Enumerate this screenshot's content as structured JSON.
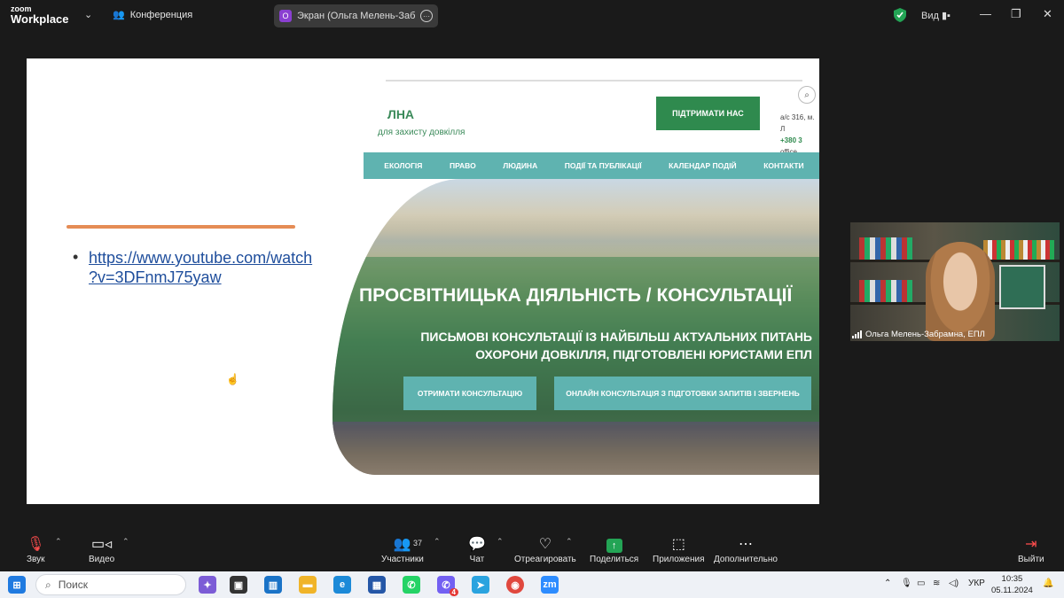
{
  "zoom": {
    "logo_top": "zoom",
    "logo_bottom": "Workplace",
    "meeting_label": "Конференция",
    "share_label": "Экран (Ольга Мелень-Забрамн",
    "share_badge": "О",
    "view_label": "Вид"
  },
  "slide": {
    "link_line1": "https://www.youtube.com/watch",
    "link_line2": "?v=3DFnmJ75yaw"
  },
  "website": {
    "brand": "ЛНА",
    "brand_sub": "для захисту довкілля",
    "support_button": "ПІДТРИМАТИ НАС",
    "contact_line1": "а/с 316, м. Л",
    "contact_line2": "+380 3",
    "contact_line3": "office",
    "nav": [
      "ЕКОЛОГІЯ",
      "ПРАВО",
      "ЛЮДИНА",
      "ПОДІЇ ТА ПУБЛІКАЦІЇ",
      "КАЛЕНДАР ПОДІЙ",
      "КОНТАКТИ"
    ],
    "hero_title": "ПРОСВІТНИЦЬКА ДІЯЛЬНІСТЬ / КОНСУЛЬТАЦІЇ",
    "hero_sub_line1": "ПИСЬМОВІ КОНСУЛЬТАЦІЇ ІЗ НАЙБІЛЬШ АКТУАЛЬНИХ ПИТАНЬ",
    "hero_sub_line2": "ОХОРОНИ ДОВКІЛЛЯ, ПІДГОТОВЛЕНІ ЮРИСТАМИ ЕПЛ",
    "button_consult": "ОТРИМАТИ КОНСУЛЬТАЦІЮ",
    "button_online": "ОНЛАЙН КОНСУЛЬТАЦІЯ З ПІДГОТОВКИ ЗАПИТІВ І ЗВЕРНЕНЬ"
  },
  "participant": {
    "name": "Ольга Мелень-Забрамна, ЕПЛ"
  },
  "toolbar": {
    "audio": "Звук",
    "video": "Видео",
    "participants": "Участники",
    "participants_count": "37",
    "chat": "Чат",
    "react": "Отреагировать",
    "share": "Поделиться",
    "apps": "Приложения",
    "more": "Дополнительно",
    "leave": "Выйти"
  },
  "taskbar": {
    "search_placeholder": "Поиск",
    "viber_badge": "4",
    "zoom_icon": "zm",
    "language": "УКР",
    "time": "10:35",
    "date": "05.11.2024"
  },
  "colors": {
    "accent_green": "#2f8a4e",
    "teal": "#5fb3b0",
    "link_blue": "#1f4e9c",
    "underline_orange": "#e58c55"
  }
}
